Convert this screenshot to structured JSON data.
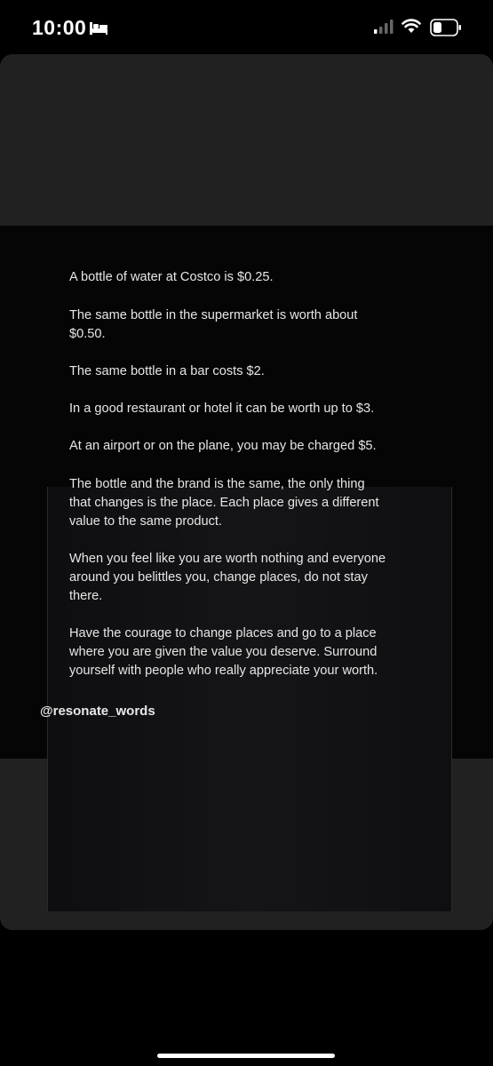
{
  "status_bar": {
    "time": "10:00",
    "icons": [
      "bed-icon",
      "cellular-signal-icon",
      "wifi-icon",
      "battery-icon"
    ]
  },
  "post": {
    "paragraphs": [
      "A bottle of water at Costco is $0.25.",
      "The same bottle in the supermarket is worth about\n$0.50.",
      "The same bottle in a bar costs $2.",
      "In a good restaurant or hotel it can be worth up to $3.",
      "At an airport or on the plane, you may be charged $5.",
      "The bottle and the brand is the same, the only thing\nthat changes is the place. Each place gives a different\nvalue to the same product.",
      "When you feel like you are worth nothing and everyone\naround you belittles you, change places, do not stay\nthere.",
      "Have the courage to change places and go to a place\nwhere you are given the value you deserve. Surround\nyourself with people who really appreciate your worth."
    ],
    "handle": "@resonate_words"
  },
  "colors": {
    "background": "#000000",
    "card": "#212121",
    "image_bg": "#050505",
    "text": "#e6e6e6"
  }
}
